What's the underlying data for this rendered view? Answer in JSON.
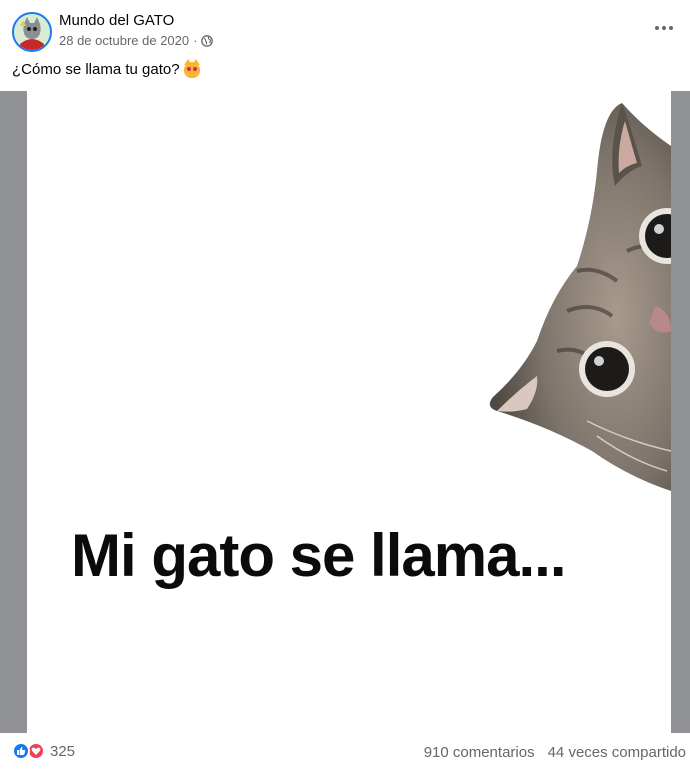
{
  "post": {
    "page_name": "Mundo del GATO",
    "date": "28 de octubre de 2020",
    "separator": "·",
    "privacy_icon": "globe-icon",
    "more_icon": "more-options-icon",
    "caption": "¿Cómo se llama tu gato?",
    "caption_emoji": "smiling-cat-heart-eyes-emoji"
  },
  "image": {
    "text": "Mi gato se llama..."
  },
  "footer": {
    "reaction_icons": [
      "like-icon",
      "love-icon"
    ],
    "reaction_count": "325",
    "comments": "910 comentarios",
    "shares": "44 veces compartido"
  },
  "colors": {
    "accent": "#1877f2",
    "love": "#f33e58",
    "secondary_text": "#65676b",
    "media_background": "#909296"
  }
}
